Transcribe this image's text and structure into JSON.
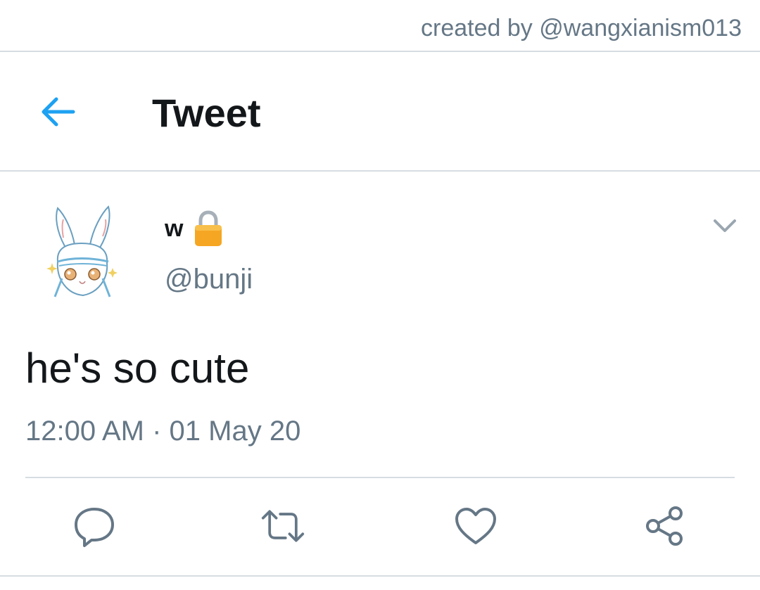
{
  "watermark": {
    "text": "created by @wangxianism013"
  },
  "header": {
    "title": "Tweet",
    "back_icon": "arrow-left-icon"
  },
  "tweet": {
    "display_name": "w",
    "protected_icon": "lock-icon",
    "handle": "@bunji",
    "text": "he's so cute",
    "timestamp": "12:00 AM · 01 May 20",
    "menu_icon": "chevron-down-icon",
    "avatar": "bunny-avatar"
  },
  "actions": [
    {
      "name": "reply",
      "icon": "reply-icon"
    },
    {
      "name": "retweet",
      "icon": "retweet-icon"
    },
    {
      "name": "like",
      "icon": "heart-icon"
    },
    {
      "name": "share",
      "icon": "share-icon"
    }
  ],
  "colors": {
    "accent": "#1da1f2",
    "secondary_text": "#657786",
    "primary_text": "#14171a",
    "divider": "#d6dde2",
    "lock": "#f5a623"
  }
}
